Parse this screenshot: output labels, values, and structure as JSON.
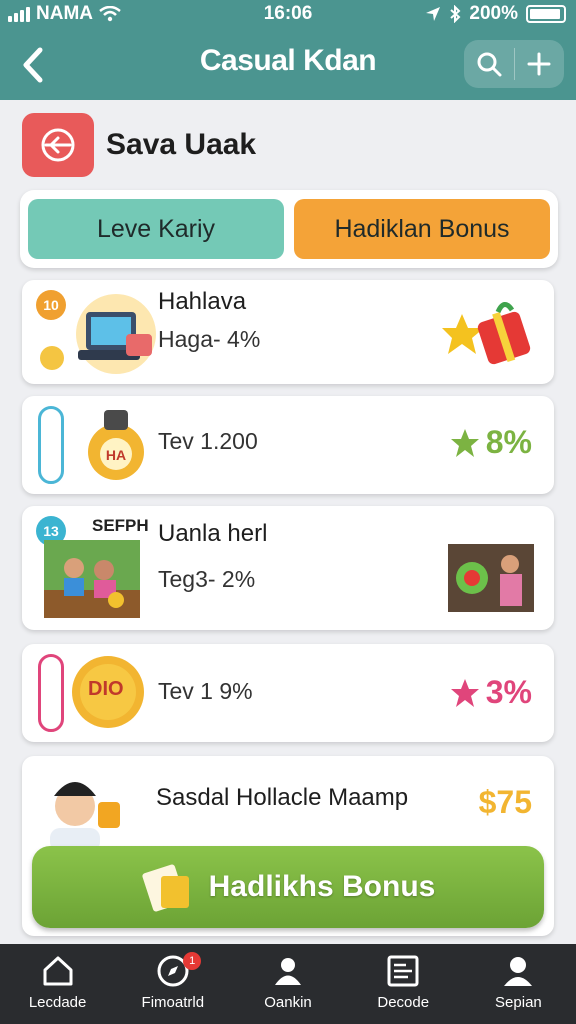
{
  "status_bar": {
    "carrier": "NAMA",
    "time": "16:06",
    "battery": "200%"
  },
  "app_bar": {
    "title": "Casual Kdan"
  },
  "section": {
    "title": "Sava Uaak"
  },
  "tabs": [
    {
      "label": "Leve Kariy"
    },
    {
      "label": "Hadiklan Bonus"
    }
  ],
  "cards": [
    {
      "badge": "10",
      "title": "Hahlava",
      "subtitle": "Haga- 4%",
      "stat": ""
    },
    {
      "title": "",
      "subtitle": "Tev 1.200",
      "stat": "8%"
    },
    {
      "badge": "13",
      "tag": "SEFPH",
      "title": "Uanla herl",
      "subtitle": "Teg3- 2%",
      "stat": ""
    },
    {
      "subtitle": "Tev 1 9%",
      "stat": "3%",
      "coin_text": "DIO"
    },
    {
      "title": "Sasdal Hollacle Maamp",
      "stat": "$75"
    }
  ],
  "cta": {
    "label": "Hadlikhs Bonus"
  },
  "bottom_nav": [
    {
      "label": "Lecdade",
      "icon": "home-icon"
    },
    {
      "label": "Fimoatrld",
      "icon": "compass-icon",
      "badge": "1"
    },
    {
      "label": "Oankin",
      "icon": "group-icon"
    },
    {
      "label": "Decode",
      "icon": "document-icon"
    },
    {
      "label": "Sepian",
      "icon": "profile-icon"
    }
  ],
  "colors": {
    "app_bar": "#4b9590",
    "tab_teal": "#74c9b6",
    "tab_orange": "#f4a338",
    "cta_green": "#7cb342",
    "stat_green": "#7cb342",
    "stat_pink": "#e0457b",
    "stat_gold": "#f2b531",
    "nav_bg": "#2a2c2f"
  }
}
